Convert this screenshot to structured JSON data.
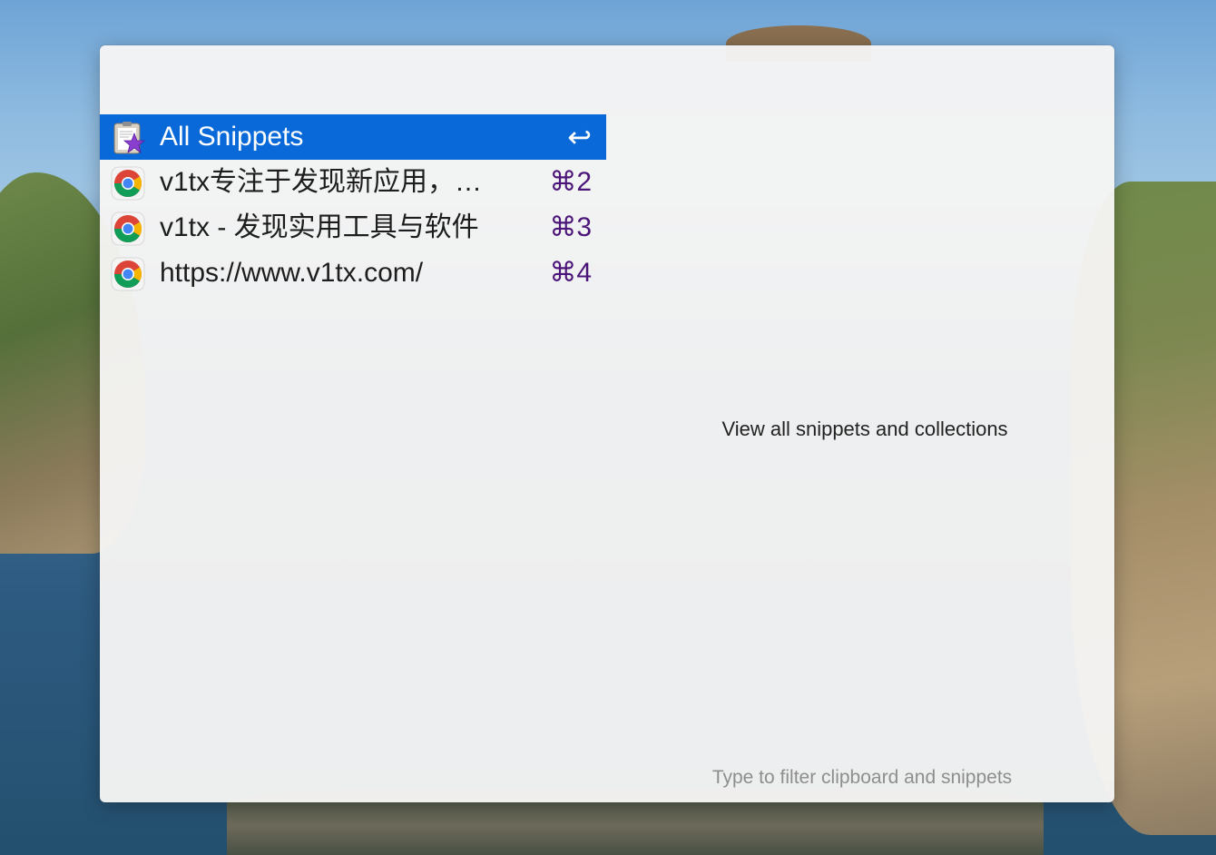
{
  "launcher": {
    "results": [
      {
        "label": "All Snippets",
        "shortcut": "↩",
        "icon": "clipboard-star-icon",
        "selected": true
      },
      {
        "label": "v1tx专注于发现新应用，…",
        "shortcut": "⌘2",
        "icon": "chrome-icon",
        "selected": false
      },
      {
        "label": "v1tx - 发现实用工具与软件",
        "shortcut": "⌘3",
        "icon": "chrome-icon",
        "selected": false
      },
      {
        "label": "https://www.v1tx.com/",
        "shortcut": "⌘4",
        "icon": "chrome-icon",
        "selected": false
      }
    ],
    "subtitle": "View all snippets and collections",
    "hint": "Type to filter clipboard and snippets"
  },
  "colors": {
    "selection": "#0a69d9",
    "shortcut": "#4b1479"
  }
}
